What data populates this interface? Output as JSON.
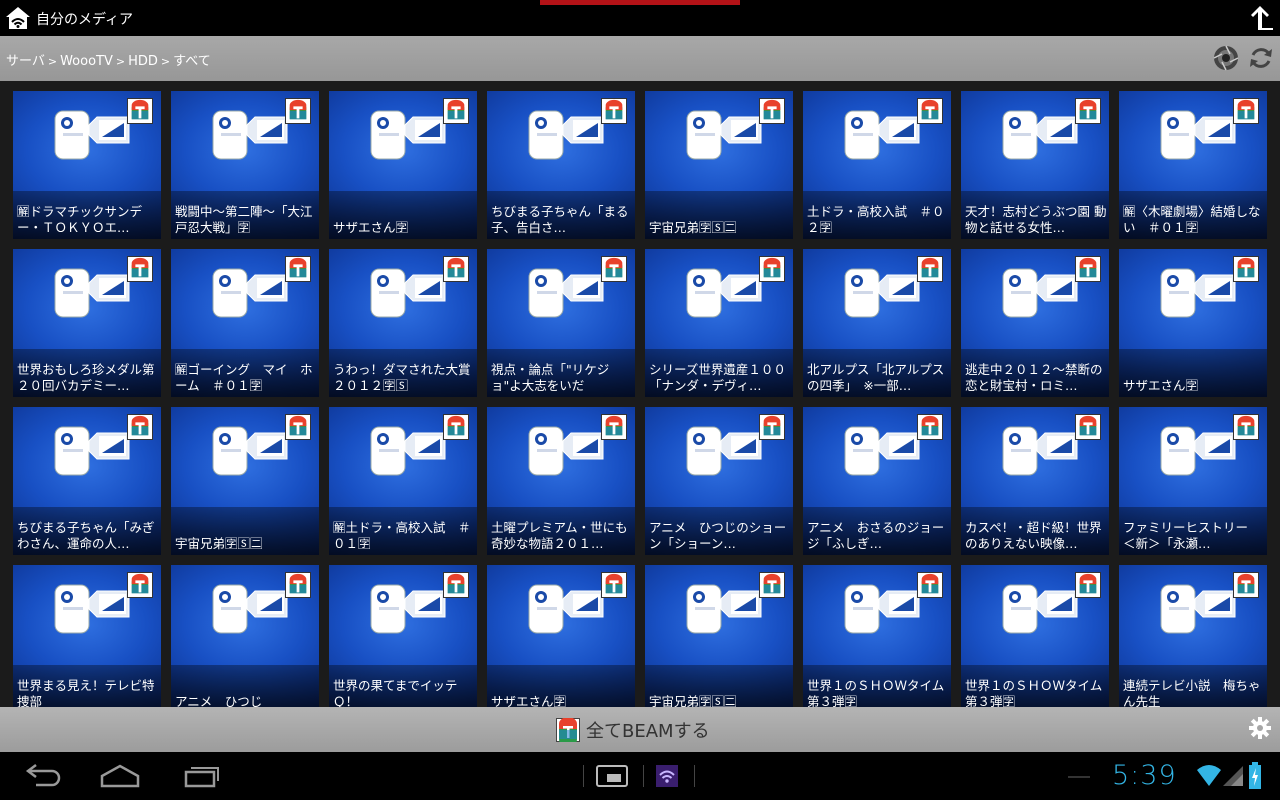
{
  "app": {
    "title": "自分のメディア"
  },
  "breadcrumb": {
    "items": [
      "サーバ",
      "WoooTV",
      "HDD",
      "すべて"
    ],
    "separator": ">"
  },
  "grid": {
    "tiles": [
      "🈖ドラマチックサンデー・ＴＯＫＹＯエ…",
      "戦闘中～第二陣～「大江戸忍大戦」🈑",
      "サザエさん🈑",
      "ちびまる子ちゃん「まる子、告白さ…",
      "宇宙兄弟🈑🅂🈔",
      "土ドラ・高校入試　＃０２🈑",
      "天才！志村どうぶつ園 動物と話せる女性…",
      "🈖〈木曜劇場〉結婚しない　＃０１🈑",
      "世界おもしろ珍メダル第２０回バカデミー…",
      "🈖ゴーイング　マイ　ホーム　＃０１🈑",
      "うわっ！ダマされた大賞２０１２🈑🅂",
      "視点・論点「\"リケジョ\"よ大志をいだ",
      "シリーズ世界遺産１００「ナンダ・デヴィ…",
      "北アルプス「北アルプスの四季」　※一部…",
      "逃走中２０１２～禁断の恋と財宝村・ロミ…",
      "サザエさん🈑",
      "ちびまる子ちゃん「みぎわさん、運命の人…",
      "宇宙兄弟🈑🅂🈔",
      "🈖土ドラ・高校入試　＃０１🈑",
      "土曜プレミアム・世にも奇妙な物語２０１…",
      "アニメ　ひつじのショーン「ショーン…",
      "アニメ　おさるのジョージ「ふしぎ…",
      "カスペ！・超ド級！世界のありえない映像…",
      "ファミリーヒストリー　＜新＞「永瀬…",
      "世界まる見え！テレビ特捜部",
      "アニメ　ひつじ",
      "世界の果てまでイッテＱ！",
      "サザエさん🈑",
      "宇宙兄弟🈑🅂🈔",
      "世界１のＳＨＯＷタイム第３弾🈑",
      "世界１のＳＨＯＷタイム第３弾🈑",
      "連続テレビ小説　梅ちゃん先生"
    ]
  },
  "actions": {
    "beam_all": "全てBEAMする"
  },
  "status": {
    "time": "5:39"
  },
  "colors": {
    "accent_red": "#b31217",
    "tile_blue": "#1850c4",
    "clock_blue": "#33b5e5"
  }
}
